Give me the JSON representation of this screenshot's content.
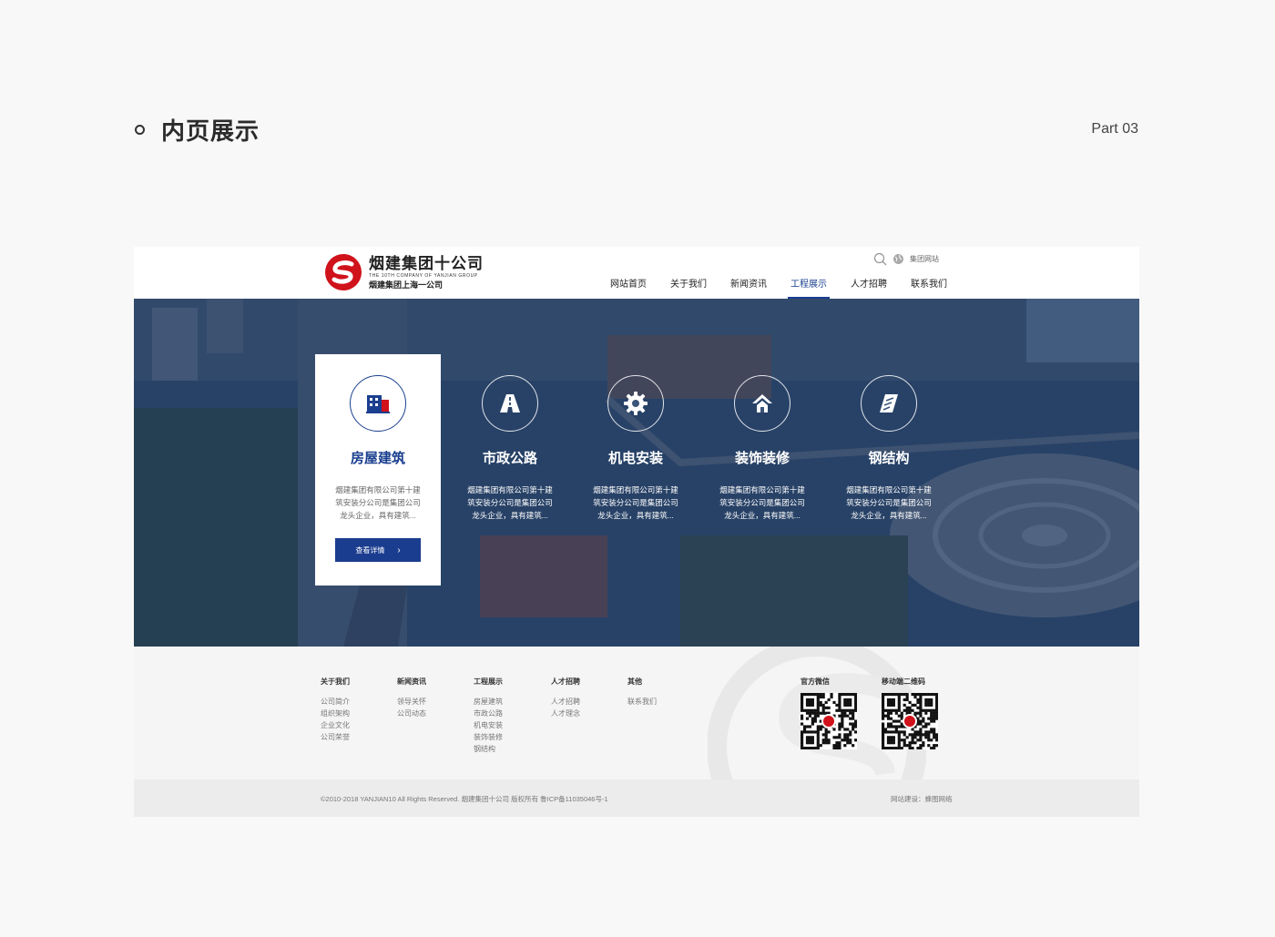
{
  "section": {
    "title": "内页展示",
    "part": "Part 03"
  },
  "header": {
    "brand_cn": "烟建集团十公司",
    "brand_en": "THE 10TH COMPANY OF YANJIAN GROUP",
    "brand_sub": "烟建集团上海一公司",
    "group_site": "集团网站",
    "nav": [
      "网站首页",
      "关于我们",
      "新闻资讯",
      "工程展示",
      "人才招聘",
      "联系我们"
    ],
    "active_nav": "工程展示"
  },
  "categories": [
    {
      "title": "房屋建筑",
      "desc": "烟建集团有限公司第十建筑安装分公司是集团公司龙头企业，具有建筑...",
      "icon": "building-icon",
      "active": true,
      "button": "查看详情"
    },
    {
      "title": "市政公路",
      "desc": "烟建集团有限公司第十建筑安装分公司是集团公司龙头企业，具有建筑...",
      "icon": "road-icon"
    },
    {
      "title": "机电安装",
      "desc": "烟建集团有限公司第十建筑安装分公司是集团公司龙头企业，具有建筑...",
      "icon": "gear-icon"
    },
    {
      "title": "装饰装修",
      "desc": "烟建集团有限公司第十建筑安装分公司是集团公司龙头企业，具有建筑...",
      "icon": "house-icon"
    },
    {
      "title": "钢结构",
      "desc": "烟建集团有限公司第十建筑安装分公司是集团公司龙头企业，具有建筑...",
      "icon": "steel-icon"
    }
  ],
  "footer": {
    "columns": [
      {
        "title": "关于我们",
        "links": [
          "公司简介",
          "组织架构",
          "企业文化",
          "公司荣誉"
        ]
      },
      {
        "title": "新闻资讯",
        "links": [
          "领导关怀",
          "公司动态"
        ]
      },
      {
        "title": "工程展示",
        "links": [
          "房屋建筑",
          "市政公路",
          "机电安装",
          "装饰装修",
          "钢结构"
        ]
      },
      {
        "title": "人才招聘",
        "links": [
          "人才招聘",
          "人才理念"
        ]
      },
      {
        "title": "其他",
        "links": [
          "联系我们"
        ]
      }
    ],
    "qr": [
      {
        "title": "官方微信"
      },
      {
        "title": "移动端二维码"
      }
    ],
    "copyright": "©2010-2018 YANJIAN10 All Rights Reserved. 烟建集团十公司 版权所有 鲁ICP备11035046号-1",
    "credit": "网站建设：蜂图网络"
  },
  "colors": {
    "primary": "#1a3f8f",
    "logo_red": "#d0121b",
    "overlay": "#16305c"
  }
}
